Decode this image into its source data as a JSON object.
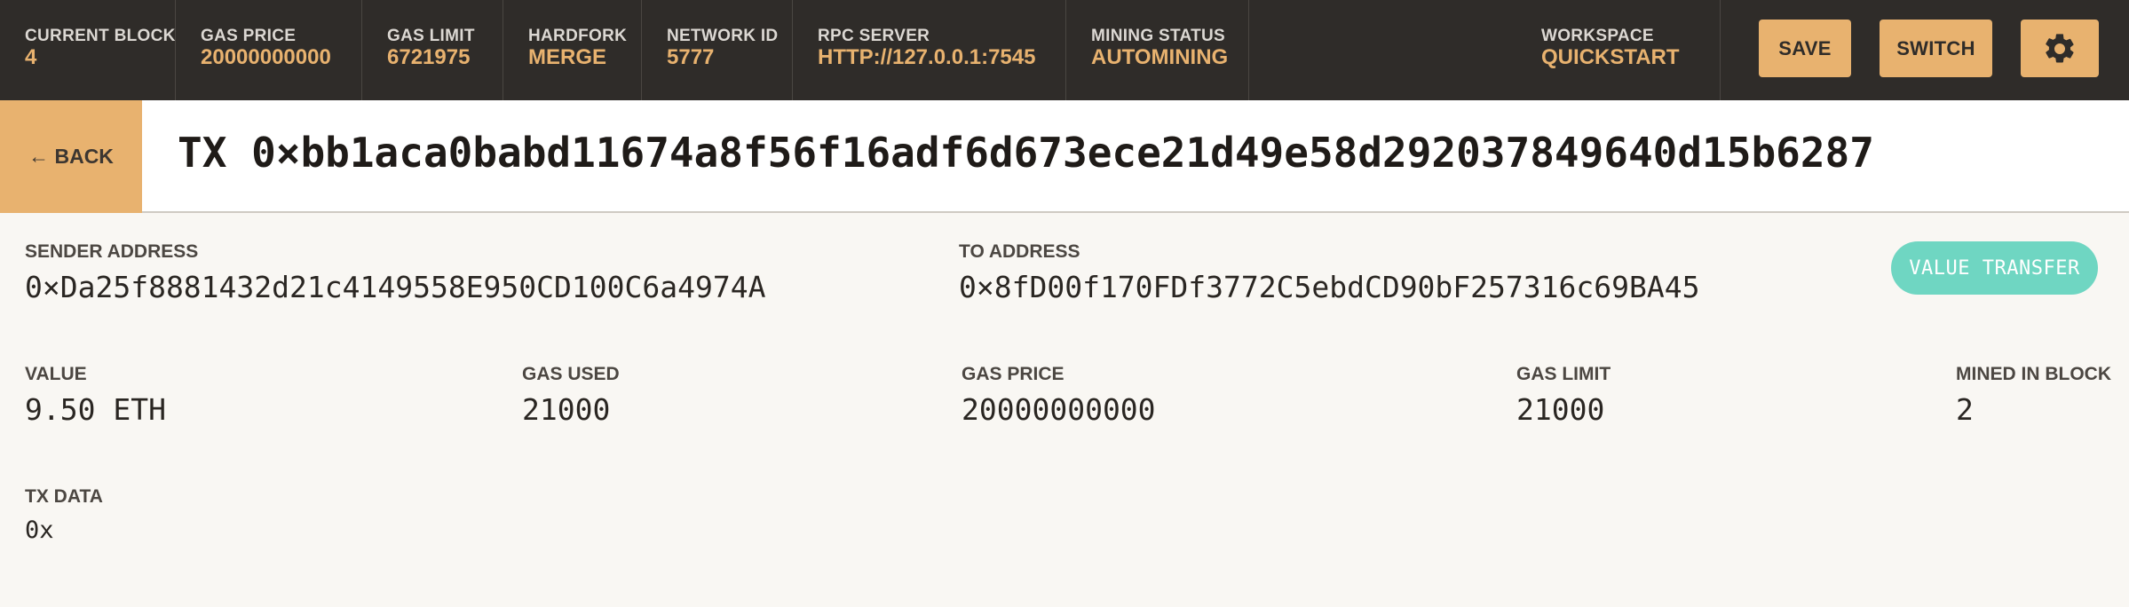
{
  "topbar": {
    "current_block": {
      "label": "CURRENT BLOCK",
      "value": "4"
    },
    "gas_price": {
      "label": "GAS PRICE",
      "value": "20000000000"
    },
    "gas_limit": {
      "label": "GAS LIMIT",
      "value": "6721975"
    },
    "hardfork": {
      "label": "HARDFORK",
      "value": "MERGE"
    },
    "network_id": {
      "label": "NETWORK ID",
      "value": "5777"
    },
    "rpc_server": {
      "label": "RPC SERVER",
      "value": "HTTP://127.0.0.1:7545"
    },
    "mining_status": {
      "label": "MINING STATUS",
      "value": "AUTOMINING"
    },
    "workspace": {
      "label": "WORKSPACE",
      "value": "QUICKSTART"
    },
    "save_label": "SAVE",
    "switch_label": "SWITCH",
    "settings_icon": "gear-icon"
  },
  "titlebar": {
    "back_label": "← BACK",
    "tx_title": "TX 0×bb1aca0babd11674a8f56f16adf6d673ece21d49e58d292037849640d15b6287"
  },
  "details": {
    "sender": {
      "label": "SENDER ADDRESS",
      "value": "0×Da25f8881432d21c4149558E950CD100C6a4974A"
    },
    "to": {
      "label": "TO ADDRESS",
      "value": "0×8fD00f170FDf3772C5ebdCD90bF257316c69BA45"
    },
    "badge": "VALUE TRANSFER",
    "value": {
      "label": "VALUE",
      "value": "9.50 ETH"
    },
    "gas_used": {
      "label": "GAS USED",
      "value": "21000"
    },
    "gas_price": {
      "label": "GAS PRICE",
      "value": "20000000000"
    },
    "gas_limit": {
      "label": "GAS LIMIT",
      "value": "21000"
    },
    "mined_in_block": {
      "label": "MINED IN BLOCK",
      "value": "2"
    },
    "tx_data": {
      "label": "TX DATA",
      "value": "0x"
    }
  },
  "colors": {
    "topbar_bg": "#2f2c29",
    "accent": "#e8b26f",
    "badge": "#6fd6c2",
    "panel_bg": "#f9f7f3"
  }
}
